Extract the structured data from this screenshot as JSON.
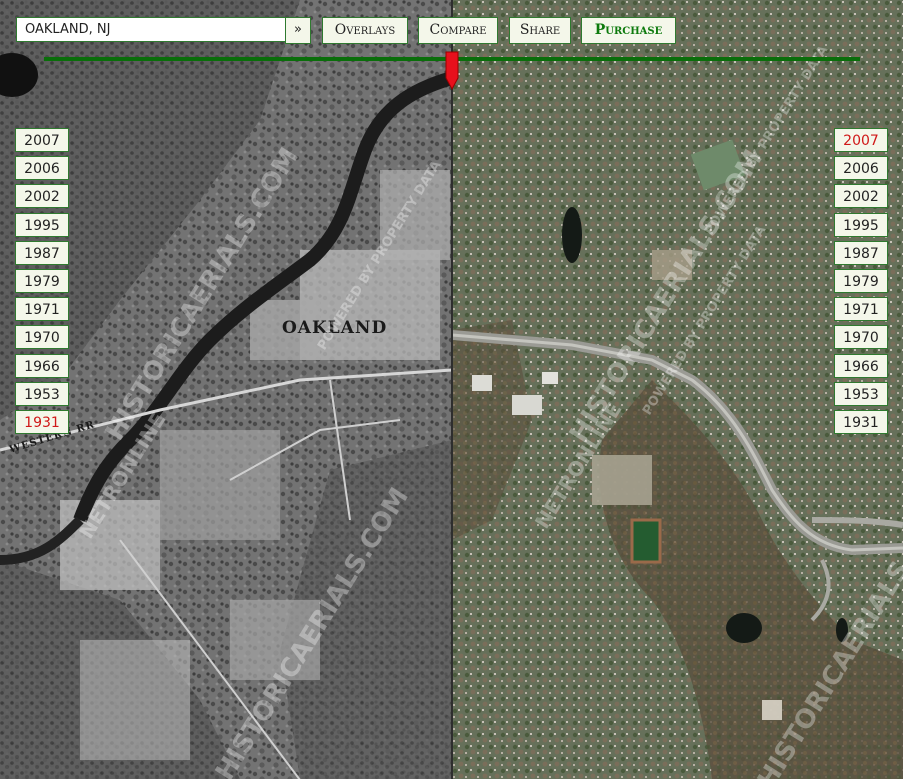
{
  "search": {
    "value": "OAKLAND, NJ",
    "go_label": "»"
  },
  "toolbar": {
    "overlays_label": "Overlays",
    "compare_label": "Compare",
    "share_label": "Share",
    "purchase_label": "Purchase"
  },
  "slider": {
    "position_percent": 49.9,
    "handle_color": "#e8101c",
    "track_color": "#0a6e0a"
  },
  "left_years": {
    "selected": "1931",
    "items": [
      "2007",
      "2006",
      "2002",
      "1995",
      "1987",
      "1979",
      "1971",
      "1970",
      "1966",
      "1953",
      "1931"
    ]
  },
  "right_years": {
    "selected": "2007",
    "items": [
      "2007",
      "2006",
      "2002",
      "1995",
      "1987",
      "1979",
      "1971",
      "1970",
      "1966",
      "1953",
      "1931"
    ]
  },
  "map": {
    "left_place_label": "OAKLAND",
    "left_rail_label": "WESTERN RR",
    "watermark_1": "HISTORICAERIALS.COM",
    "watermark_2": "NETRONLINE",
    "watermark_3": "POWERED BY PROPERTY DATA"
  }
}
